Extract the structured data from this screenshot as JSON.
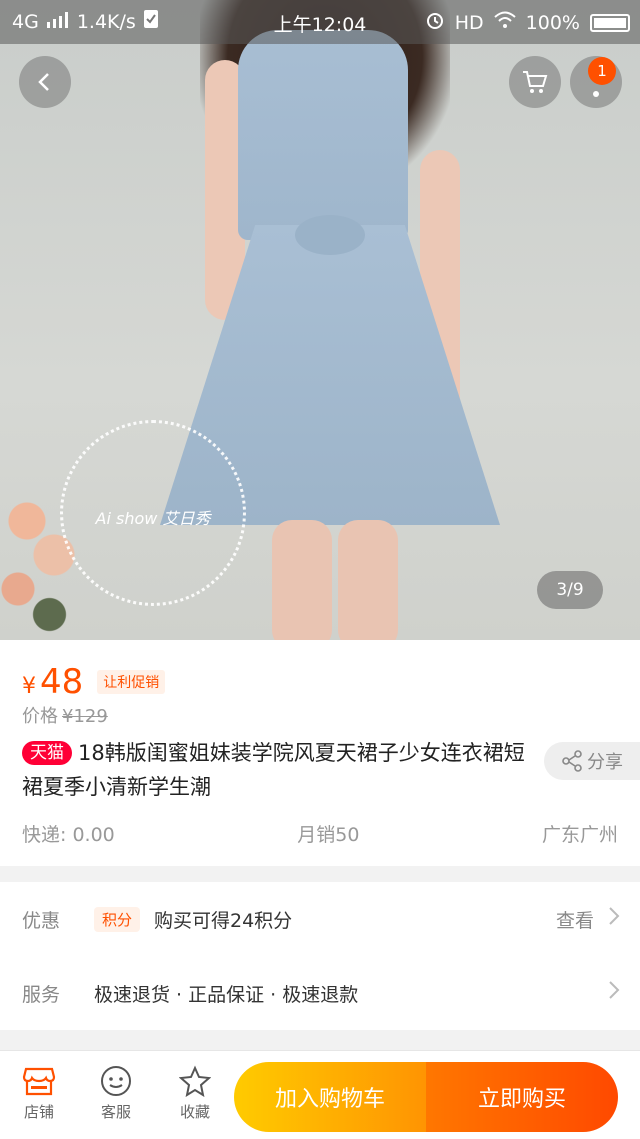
{
  "status_bar": {
    "network": "4G",
    "speed": "1.4K/s",
    "time": "上午12:04",
    "hd": "HD",
    "battery": "100%"
  },
  "gallery": {
    "counter": "3/9",
    "cart_badge": "1",
    "watermark": "Ai show 艾日秀"
  },
  "product": {
    "currency": "¥",
    "price": "48",
    "promo_tag": "让利促销",
    "original_label": "价格",
    "original_price": "¥129",
    "store_tag": "天猫",
    "title": "18韩版闺蜜姐妹装学院风夏天裙子少女连衣裙短裙夏季小清新学生潮",
    "share_label": "分享",
    "shipping": "快递: 0.00",
    "monthly_sales": "月销50",
    "location": "广东广州"
  },
  "benefits": {
    "label": "优惠",
    "tag": "积分",
    "text": "购买可得24积分",
    "action": "查看"
  },
  "services": {
    "label": "服务",
    "text": "极速退货 · 正品保证 · 极速退款"
  },
  "bottom_bar": {
    "shop": "店铺",
    "service": "客服",
    "favorite": "收藏",
    "add_to_cart": "加入购物车",
    "buy_now": "立即购买"
  },
  "colors": {
    "accent": "#ff5000",
    "tmall": "#ff0036",
    "cart_button": "#ffb000",
    "buy_button": "#ff5a00"
  }
}
